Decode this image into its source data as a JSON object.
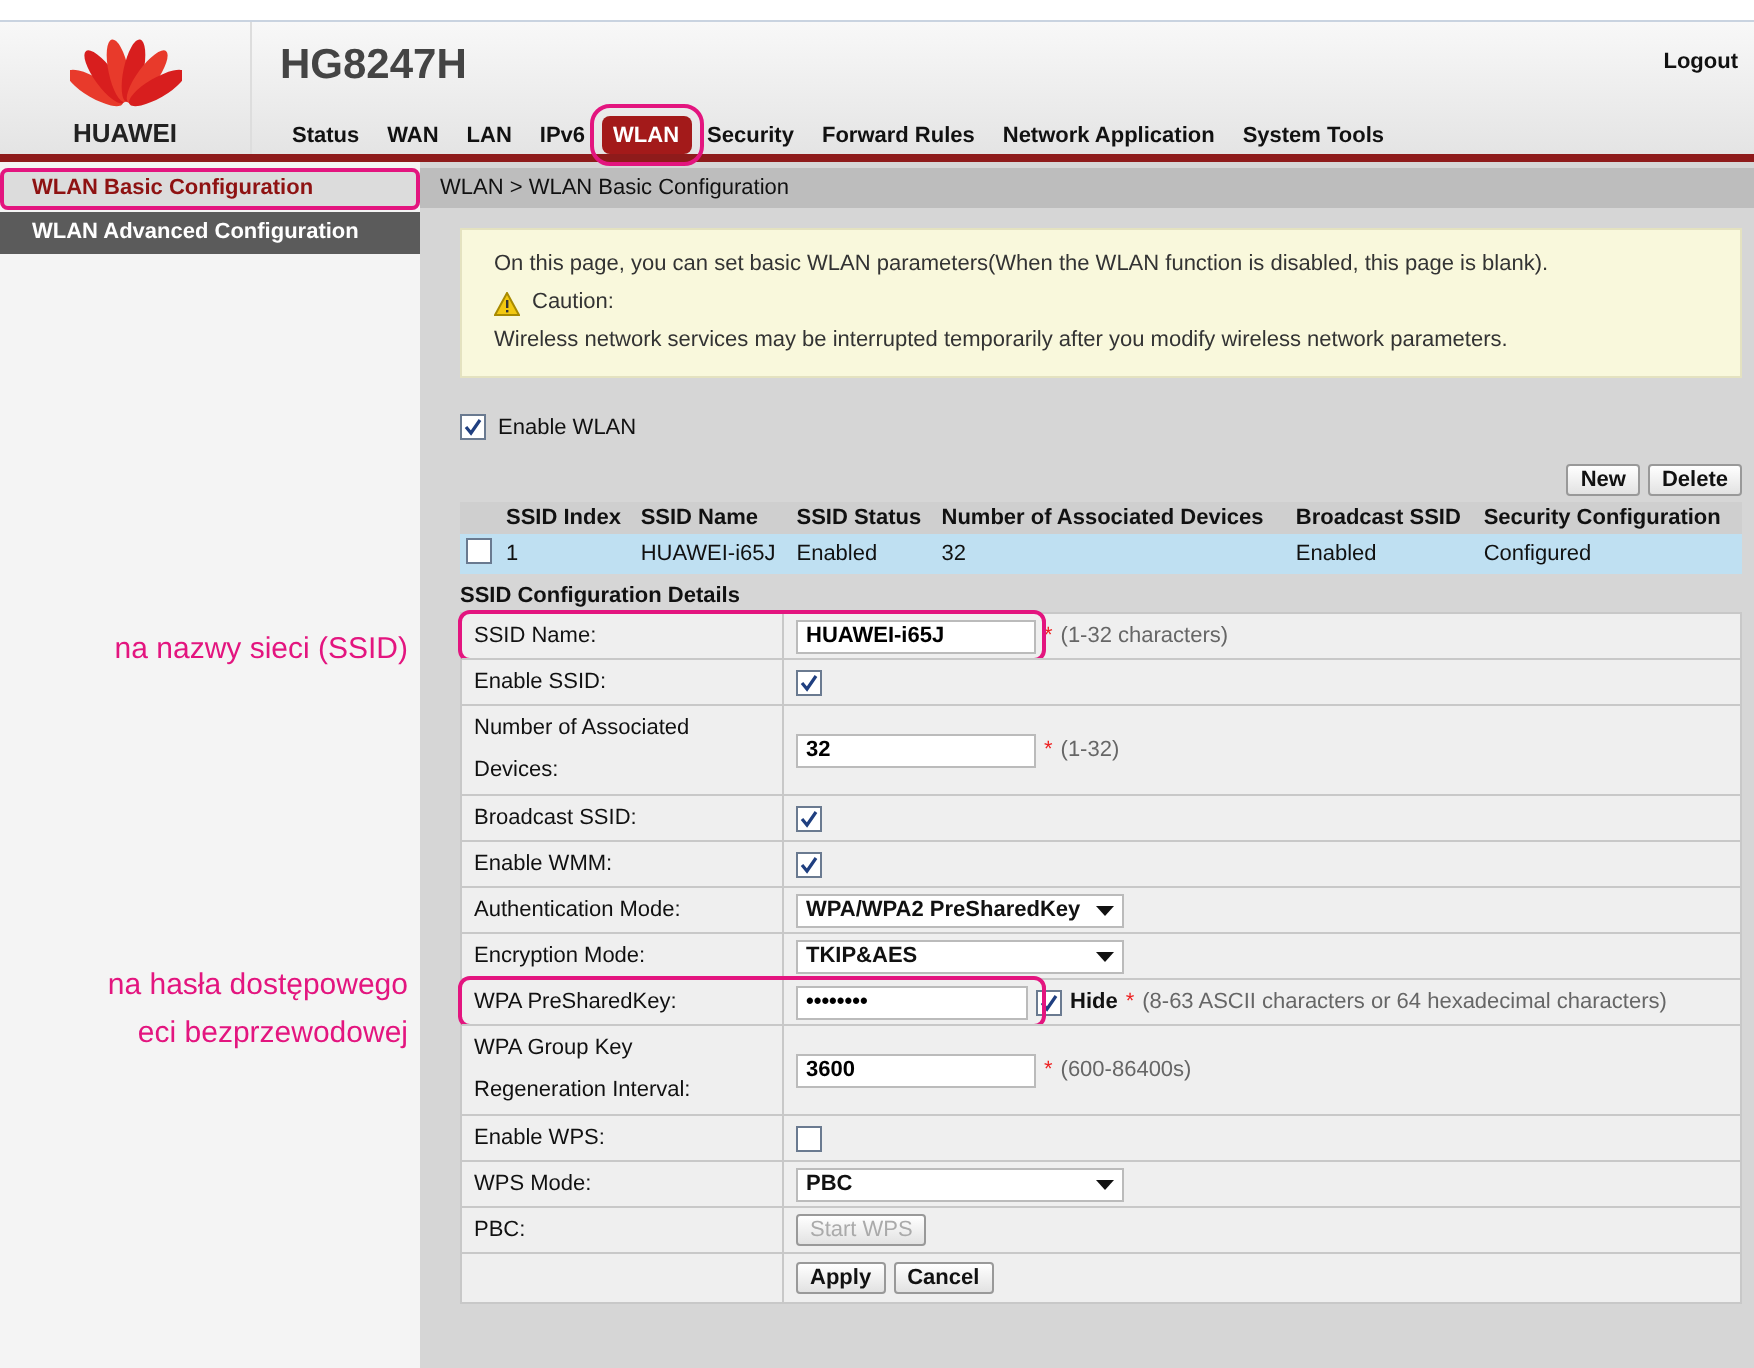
{
  "header": {
    "brand": "HUAWEI",
    "model": "HG8247H",
    "logout": "Logout"
  },
  "nav": [
    {
      "label": "Status",
      "selected": false,
      "highlighted": false
    },
    {
      "label": "WAN",
      "selected": false,
      "highlighted": false
    },
    {
      "label": "LAN",
      "selected": false,
      "highlighted": false
    },
    {
      "label": "IPv6",
      "selected": false,
      "highlighted": false
    },
    {
      "label": "WLAN",
      "selected": true,
      "highlighted": true
    },
    {
      "label": "Security",
      "selected": false,
      "highlighted": false
    },
    {
      "label": "Forward Rules",
      "selected": false,
      "highlighted": false
    },
    {
      "label": "Network Application",
      "selected": false,
      "highlighted": false
    },
    {
      "label": "System Tools",
      "selected": false,
      "highlighted": false
    }
  ],
  "sidebar": [
    {
      "label": "WLAN Basic Configuration",
      "selected": true,
      "highlighted": true
    },
    {
      "label": "WLAN Advanced Configuration",
      "selected": false,
      "highlighted": false
    }
  ],
  "breadcrumb": "WLAN > WLAN Basic Configuration",
  "notice": {
    "text": "On this page, you can set basic WLAN parameters(When the WLAN function is disabled, this page is blank).",
    "caution": "Caution:",
    "warning": "Wireless network services may be interrupted temporarily after you modify wireless network parameters."
  },
  "enable_wlan": {
    "label": "Enable WLAN",
    "checked": true
  },
  "table_buttons": [
    "New",
    "Delete"
  ],
  "ssid_table": {
    "columns": [
      "SSID Index",
      "SSID Name",
      "SSID Status",
      "Number of Associated Devices",
      "Broadcast SSID",
      "Security Configuration"
    ],
    "rows": [
      {
        "checked": false,
        "cells": [
          "1",
          "HUAWEI-i65J",
          "Enabled",
          "32",
          "Enabled",
          "Configured"
        ]
      }
    ]
  },
  "details": {
    "title": "SSID Configuration Details",
    "rows": [
      {
        "kind": "text",
        "label": "SSID Name:",
        "value": "HUAWEI-i65J",
        "mark": "*",
        "hint": "(1-32 characters)",
        "highlighted": true
      },
      {
        "kind": "checkbox",
        "label": "Enable SSID:",
        "checked": true
      },
      {
        "kind": "text",
        "label": "Number of Associated Devices:",
        "value": "32",
        "mark": "*",
        "hint": "(1-32)"
      },
      {
        "kind": "checkbox",
        "label": "Broadcast SSID:",
        "checked": true
      },
      {
        "kind": "checkbox",
        "label": "Enable WMM:",
        "checked": true
      },
      {
        "kind": "select",
        "label": "Authentication Mode:",
        "value": "WPA/WPA2 PreSharedKey"
      },
      {
        "kind": "select",
        "label": "Encryption Mode:",
        "value": "TKIP&AES"
      },
      {
        "kind": "password",
        "label": "WPA PreSharedKey:",
        "value": "••••••••",
        "hide_label": "Hide",
        "hide_checked": true,
        "mark": "*",
        "hint": "(8-63 ASCII characters or 64 hexadecimal characters)",
        "highlighted": true
      },
      {
        "kind": "text",
        "label": "WPA Group Key Regeneration Interval:",
        "value": "3600",
        "mark": "*",
        "hint": "(600-86400s)"
      },
      {
        "kind": "checkbox",
        "label": "Enable WPS:",
        "checked": false
      },
      {
        "kind": "select",
        "label": "WPS Mode:",
        "value": "PBC"
      },
      {
        "kind": "button",
        "label": "PBC:",
        "value": "Start WPS",
        "disabled": true
      }
    ],
    "buttons": [
      "Apply",
      "Cancel"
    ]
  },
  "annotations": [
    {
      "lines": [
        "na nazwy sieci (SSID)"
      ]
    },
    {
      "lines": [
        "na hasła dostępowego",
        "eci bezprzewodowej"
      ]
    }
  ]
}
